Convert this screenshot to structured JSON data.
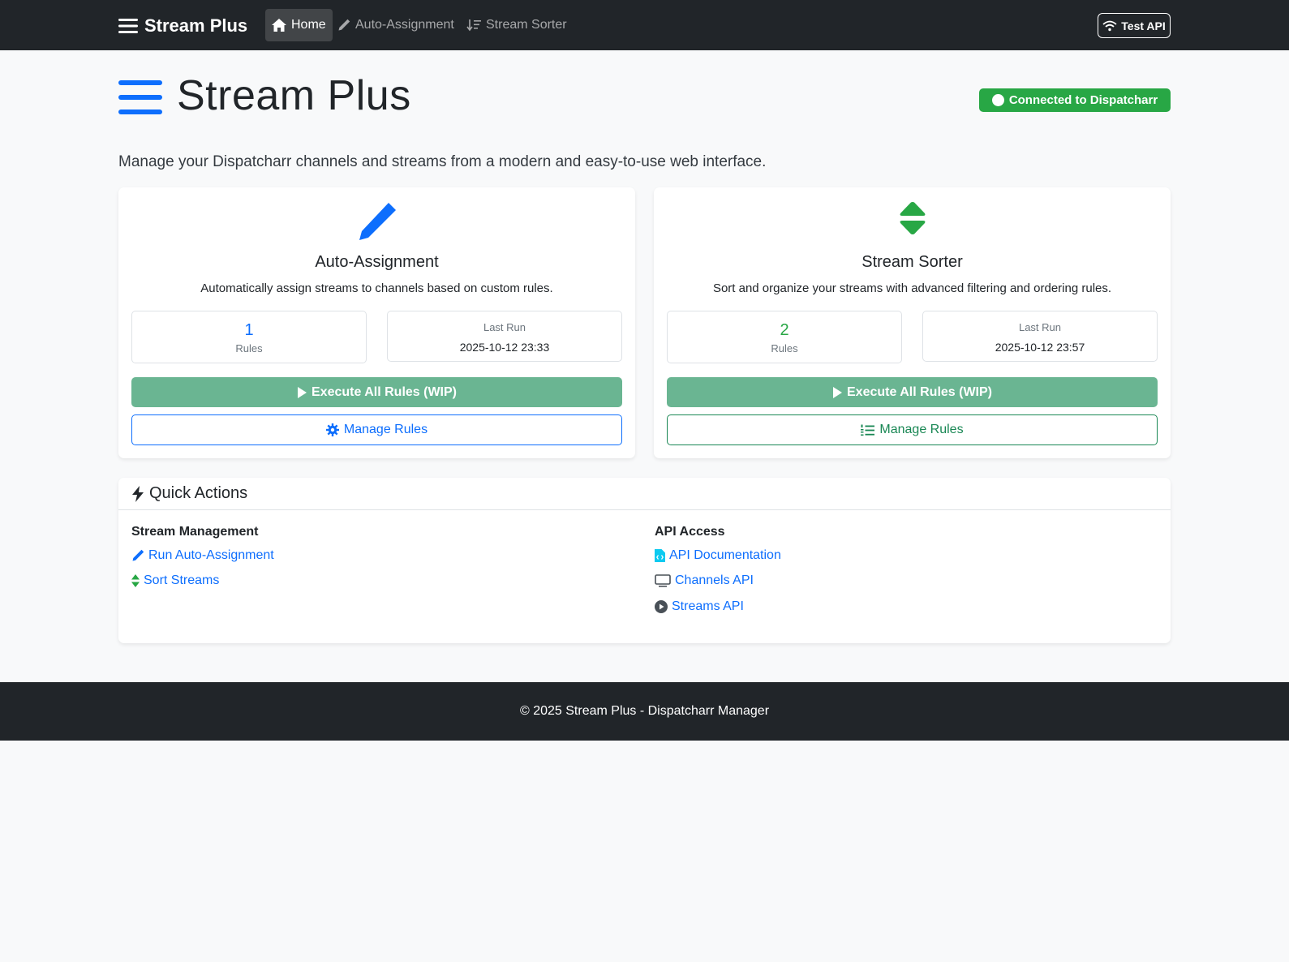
{
  "navbar": {
    "brand": "Stream Plus",
    "links": [
      {
        "label": "Home",
        "icon": "home-icon",
        "active": true
      },
      {
        "label": "Auto-Assignment",
        "icon": "pencil-icon",
        "active": false
      },
      {
        "label": "Stream Sorter",
        "icon": "sort-icon",
        "active": false
      }
    ],
    "test_api_label": "Test API"
  },
  "header": {
    "title": "Stream Plus",
    "status": "Connected to Dispatcharr",
    "lead": "Manage your Dispatcharr channels and streams from a modern and easy-to-use web interface."
  },
  "cards": [
    {
      "title": "Auto-Assignment",
      "icon": "pencil-icon",
      "icon_color": "#0d6efd",
      "description": "Automatically assign streams to channels based on custom rules.",
      "rules_count": "1",
      "rules_label": "Rules",
      "last_run_label": "Last Run",
      "last_run": "2025-10-12 23:33",
      "execute_label": "Execute All Rules (WIP)",
      "manage_label": "Manage Rules",
      "manage_icon": "gear-icon",
      "accent": "#0d6efd"
    },
    {
      "title": "Stream Sorter",
      "icon": "sort-arrows-icon",
      "icon_color": "#28a745",
      "description": "Sort and organize your streams with advanced filtering and ordering rules.",
      "rules_count": "2",
      "rules_label": "Rules",
      "last_run_label": "Last Run",
      "last_run": "2025-10-12 23:57",
      "execute_label": "Execute All Rules (WIP)",
      "manage_label": "Manage Rules",
      "manage_icon": "ordered-list-icon",
      "accent": "#198754"
    }
  ],
  "quick_actions": {
    "title": "Quick Actions",
    "stream_management": {
      "title": "Stream Management",
      "links": [
        "Run Auto-Assignment",
        "Sort Streams"
      ]
    },
    "api_access": {
      "title": "API Access",
      "links": [
        "API Documentation",
        "Channels API",
        "Streams API"
      ]
    }
  },
  "footer": {
    "text": "© 2025 Stream Plus - Dispatcharr Manager"
  }
}
